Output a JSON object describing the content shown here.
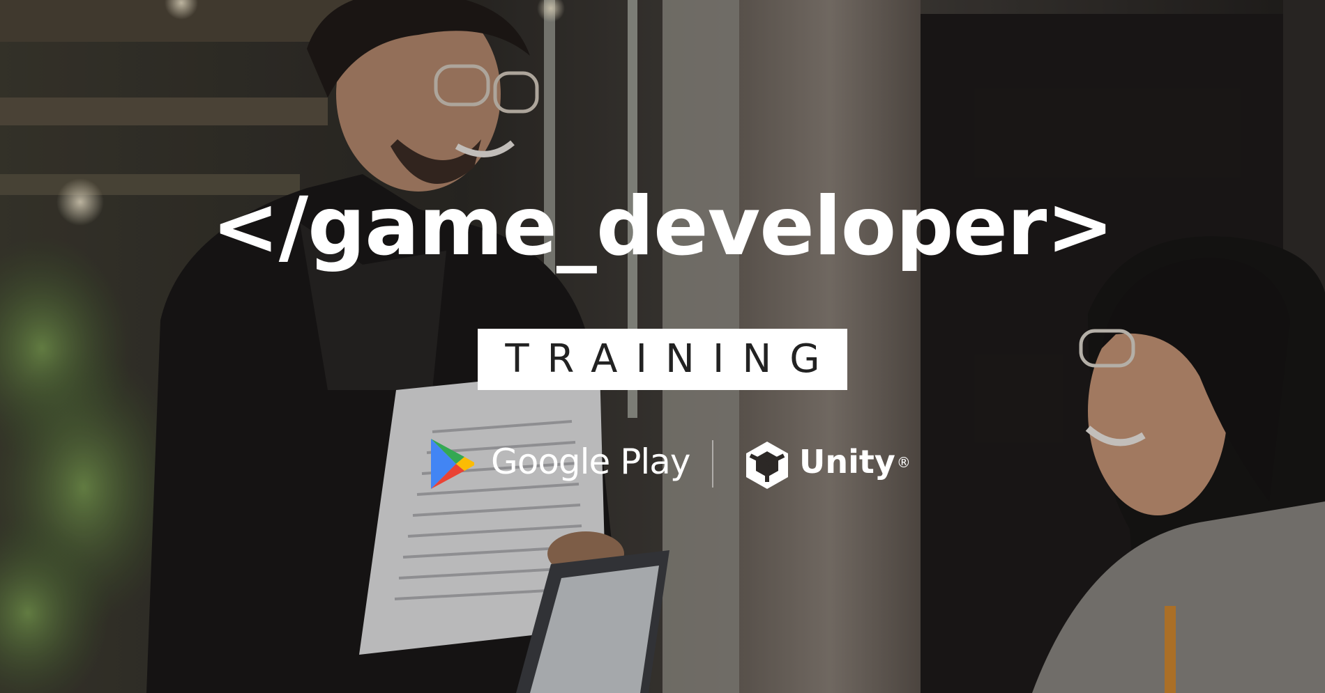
{
  "headline": {
    "text": "</game_developer>"
  },
  "badge": {
    "label": "TRAINING"
  },
  "partners": {
    "google_play": {
      "label": "Google Play",
      "icon": "google-play-logo",
      "colors": {
        "blue": "#4285F4",
        "green": "#34A853",
        "yellow": "#FBBC04",
        "red": "#EA4335"
      }
    },
    "unity": {
      "label": "Unity",
      "trademark": "®",
      "icon": "unity-logo"
    }
  },
  "colors": {
    "text": "#ffffff",
    "badge_bg": "#ffffff",
    "badge_text": "#222222"
  }
}
